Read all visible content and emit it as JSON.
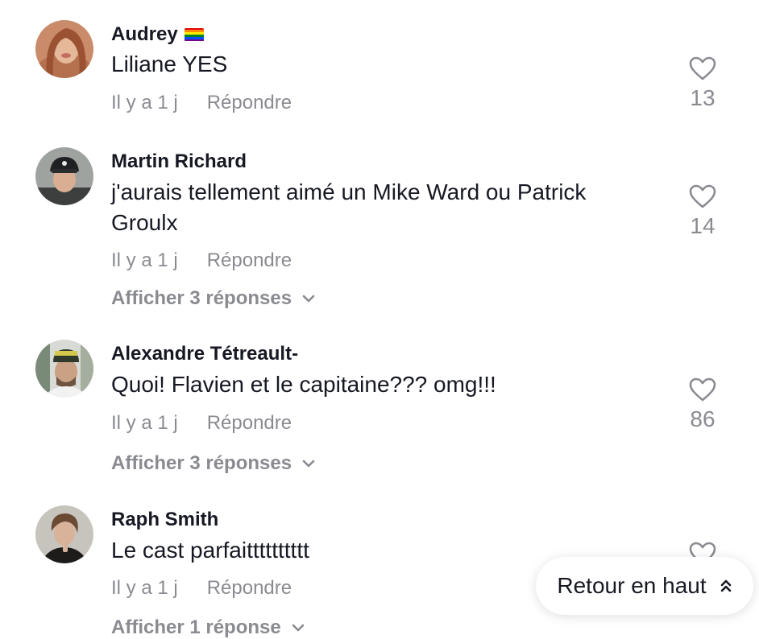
{
  "comments": [
    {
      "username": "Audrey",
      "text": "Liliane YES",
      "time": "Il y a 1 j",
      "reply": "Répondre",
      "likes": "13",
      "replies": ""
    },
    {
      "username": "Martin Richard",
      "text": "j'aurais tellement aimé un Mike Ward ou Patrick Groulx",
      "time": "Il y a 1 j",
      "reply": "Répondre",
      "likes": "14",
      "replies": "Afficher 3 réponses"
    },
    {
      "username": "Alexandre Tétreault-",
      "text": "Quoi! Flavien et le capitaine??? omg!!!",
      "time": "Il y a 1 j",
      "reply": "Répondre",
      "likes": "86",
      "replies": "Afficher 3 réponses"
    },
    {
      "username": "Raph Smith",
      "text": "Le cast parfaitttttttttt",
      "time": "Il y a 1 j",
      "reply": "Répondre",
      "likes": "",
      "replies": "Afficher 1 réponse"
    }
  ],
  "back_to_top": {
    "label": "Retour en haut"
  },
  "icons": {
    "like": "heart-outline-icon",
    "expand": "chevron-down-icon",
    "scroll_up": "double-chevron-up-icon",
    "flag": "rainbow-flag-emoji"
  },
  "colors": {
    "text": "#161823",
    "muted": "#8a8b91",
    "background": "#ffffff"
  }
}
